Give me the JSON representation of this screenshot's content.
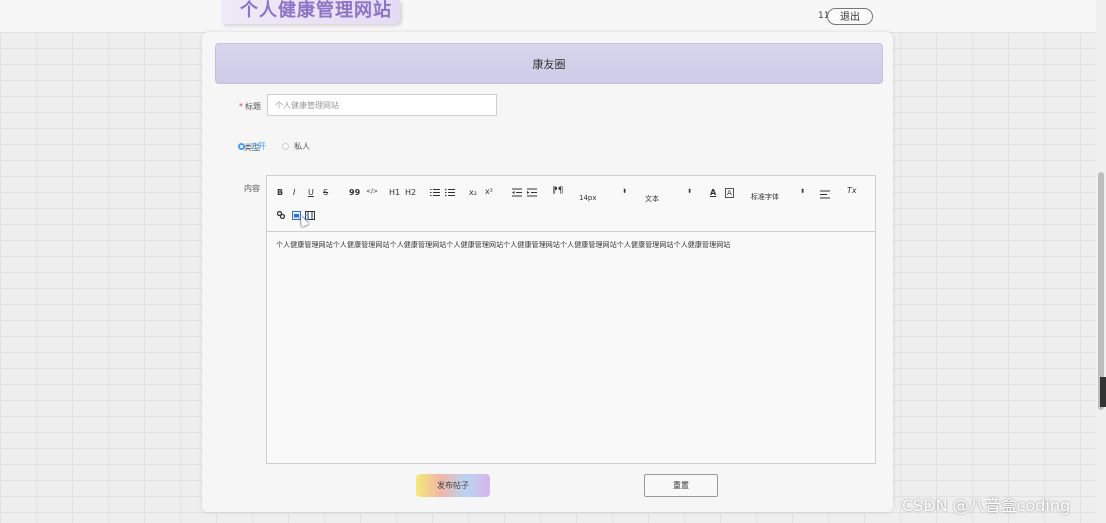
{
  "header": {
    "site_title": "个人健康管理网站",
    "user_id": "11",
    "logout_label": "退出"
  },
  "page": {
    "section_title": "康友圈"
  },
  "form": {
    "title_required_mark": "*",
    "title_label": "标题",
    "title_value": "个人健康管理网站",
    "type_label": "类型",
    "type_options": [
      {
        "label": "公开",
        "selected": true
      },
      {
        "label": "私人",
        "selected": false
      }
    ],
    "content_label": "内容",
    "content_text": "个人健康管理网站个人健康管理网站个人健康管理网站个人健康管理网站个人健康管理网站个人健康管理网站个人健康管理网站个人健康管理网站",
    "publish_label": "发布帖子",
    "reset_label": "重置"
  },
  "toolbar": {
    "bold": "B",
    "italic": "I",
    "underline": "U",
    "strike": "S",
    "quote": "99",
    "code": "</>",
    "h1": "H1",
    "h2": "H2",
    "subscript": "x₂",
    "superscript": "x²",
    "font_size": "14px",
    "text_style": "文本",
    "font_family": "标准字体",
    "select_arrow": "⬍",
    "text_color": "A",
    "bg_color": "A",
    "clear_format": "Tx"
  },
  "watermark": "CSDN @八音盒coding",
  "colors": {
    "accent": "#409eff",
    "title_purple": "#8d74c7",
    "header_band": "#d8d6ee"
  }
}
